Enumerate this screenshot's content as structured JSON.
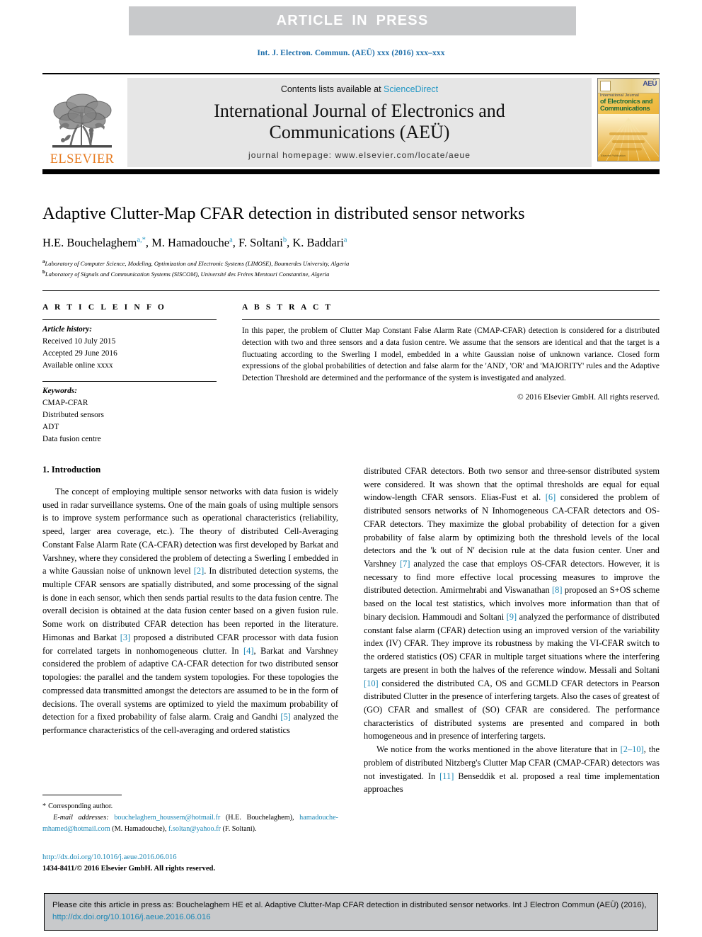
{
  "banner": {
    "text": "ARTICLE IN PRESS"
  },
  "running_head": "Int. J. Electron. Commun. (AEÜ) xxx (2016) xxx–xxx",
  "masthead": {
    "publisher_wordmark": "ELSEVIER",
    "contents_prefix": "Contents lists available at ",
    "contents_link": "ScienceDirect",
    "journal_title_line1": "International Journal of Electronics and",
    "journal_title_line2": "Communications (AEÜ)",
    "homepage": "journal homepage: www.elsevier.com/locate/aeue",
    "cover": {
      "badge": "AEÜ",
      "small_caption": "International Journal",
      "line1": "of Electronics and",
      "line2": "Communications",
      "footer": "Elsevier Publication"
    }
  },
  "title": "Adaptive Clutter-Map CFAR detection in distributed sensor networks",
  "authors": [
    {
      "name": "H.E. Bouchelaghem",
      "marks": "a,*"
    },
    {
      "name": "M. Hamadouche",
      "marks": "a"
    },
    {
      "name": "F. Soltani",
      "marks": "b"
    },
    {
      "name": "K. Baddari",
      "marks": "a"
    }
  ],
  "affiliations": [
    {
      "mark": "a",
      "text": "Laboratory of Computer Science, Modeling, Optimization and Electronic Systems (LIMOSE), Boumerdes University, Algeria"
    },
    {
      "mark": "b",
      "text": "Laboratory of Signals and Communication Systems (SISCOM), Université des Fréres Mentouri Constantine, Algeria"
    }
  ],
  "article_info": {
    "heading": "A R T I C L E  I N F O",
    "history_label": "Article history:",
    "history": [
      "Received 10 July 2015",
      "Accepted 29 June 2016",
      "Available online xxxx"
    ],
    "keywords_label": "Keywords:",
    "keywords": [
      "CMAP-CFAR",
      "Distributed sensors",
      "ADT",
      "Data fusion centre"
    ]
  },
  "abstract": {
    "heading": "A B S T R A C T",
    "text": "In this paper, the problem of Clutter Map Constant False Alarm Rate (CMAP-CFAR) detection is considered for a distributed detection with two and three sensors and a data fusion centre. We assume that the sensors are identical and that the target is a fluctuating according to the Swerling I model, embedded in a white Gaussian noise of unknown variance. Closed form expressions of the global probabilities of detection and false alarm for the 'AND', 'OR' and 'MAJORITY' rules and the Adaptive Detection Threshold are determined and the performance of the system is investigated and analyzed.",
    "copyright": "© 2016 Elsevier GmbH. All rights reserved."
  },
  "body": {
    "section_title": "1. Introduction",
    "left_column": [
      "The concept of employing multiple sensor networks with data fusion is widely used in radar surveillance systems. One of the main goals of using multiple sensors is to improve system performance such as operational characteristics (reliability, speed, larger area coverage, etc.). The theory of distributed Cell-Averaging Constant False Alarm Rate (CA-CFAR) detection was first developed by Barkat and Varshney, where they considered the problem of detecting a Swerling I embedded in a white Gaussian noise of unknown level [2]. In distributed detection systems, the multiple CFAR sensors are spatially distributed, and some processing of the signal is done in each sensor, which then sends partial results to the data fusion centre. The overall decision is obtained at the data fusion center based on a given fusion rule. Some work on distributed CFAR detection has been reported in the literature. Himonas and Barkat [3] proposed a distributed CFAR processor with data fusion for correlated targets in nonhomogeneous clutter. In [4], Barkat and Varshney considered the problem of adaptive CA-CFAR detection for two distributed sensor topologies: the parallel and the tandem system topologies. For these topologies the compressed data transmitted amongst the detectors are assumed to be in the form of decisions. The overall systems are optimized to yield the maximum probability of detection for a fixed probability of false alarm. Craig and Gandhi [5] analyzed the performance characteristics of the cell-averaging and ordered statistics"
    ],
    "right_column": [
      "distributed CFAR detectors. Both two sensor and three-sensor distributed system were considered. It was shown that the optimal thresholds are equal for equal window-length CFAR sensors. Elias-Fust et al. [6] considered the problem of distributed sensors networks of N Inhomogeneous CA-CFAR detectors and OS-CFAR detectors. They maximize the global probability of detection for a given probability of false alarm by optimizing both the threshold levels of the local detectors and the 'k out of N' decision rule at the data fusion center. Uner and Varshney [7] analyzed the case that employs OS-CFAR detectors. However, it is necessary to find more effective local processing measures to improve the distributed detection. Amirmehrabi and Viswanathan [8] proposed an S+OS scheme based on the local test statistics, which involves more information than that of binary decision. Hammoudi and Soltani [9] analyzed the performance of distributed constant false alarm (CFAR) detection using an improved version of the variability index (IV) CFAR. They improve its robustness by making the VI-CFAR switch to the ordered statistics (OS) CFAR in multiple target situations where the interfering targets are present in both the halves of the reference window. Messali and Soltani [10] considered the distributed CA, OS and GCMLD CFAR detectors in Pearson distributed Clutter in the presence of interfering targets. Also the cases of greatest of (GO) CFAR and smallest of (SO) CFAR are considered. The performance characteristics of distributed systems are presented and compared in both homogeneous and in presence of interfering targets.",
      "We notice from the works mentioned in the above literature that in [2–10], the problem of distributed Nitzberg's Clutter Map CFAR (CMAP-CFAR) detectors was not investigated. In [11] Benseddik et al. proposed a real time implementation approaches"
    ]
  },
  "footnote": {
    "corresponding": "Corresponding author.",
    "email_label": "E-mail addresses:",
    "emails": [
      {
        "address": "bouchelaghem_houssem@hotmail.fr",
        "owner": "(H.E. Bouchelaghem),"
      },
      {
        "address": "hamadouche-mhamed@hotmail.com",
        "owner": "(M. Hamadouche),"
      },
      {
        "address": "f.soltan@yahoo.fr",
        "owner": "(F. Soltani)."
      }
    ]
  },
  "doi": {
    "url": "http://dx.doi.org/10.1016/j.aeue.2016.06.016",
    "issn_line": "1434-8411/© 2016 Elsevier GmbH. All rights reserved."
  },
  "citation_footer": {
    "text_before_link": "Please cite this article in press as: Bouchelaghem HE et al. Adaptive Clutter-Map CFAR detection in distributed sensor networks. Int J Electron Commun (AEÜ) (2016), ",
    "link": "http://dx.doi.org/10.1016/j.aeue.2016.06.016"
  },
  "colors": {
    "link": "#1b87b5",
    "sciencedirect": "#2196c4",
    "elsevier_orange": "#e77b20",
    "banner_grey": "#c8c9cb",
    "box_grey": "#e6e6e6"
  }
}
